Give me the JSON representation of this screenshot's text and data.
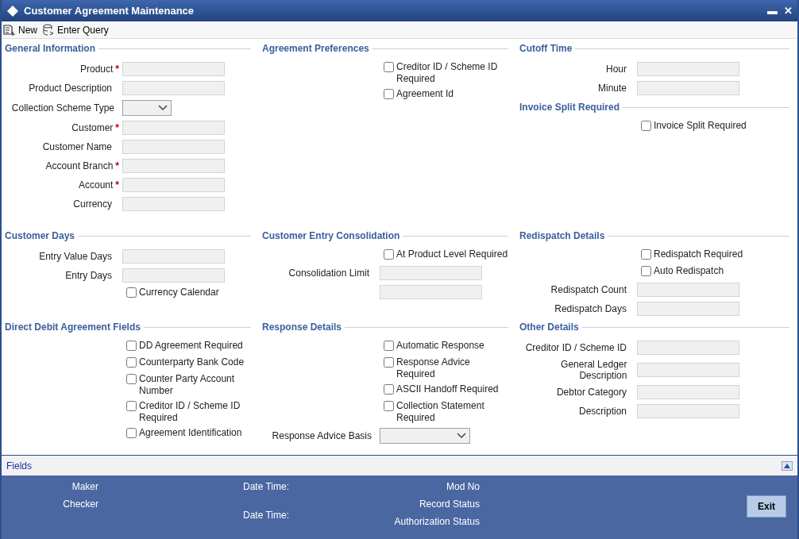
{
  "window": {
    "title": "Customer Agreement Maintenance",
    "controls": [
      "▬",
      "✕"
    ]
  },
  "toolbar": [
    {
      "label": "New",
      "kind": "new"
    },
    {
      "label": "Enter Query",
      "kind": "query"
    }
  ],
  "bands": [
    [
      [
        {
          "title": "General Information",
          "items": [
            {
              "kind": "field",
              "label": "Product",
              "required_mark": "*"
            },
            {
              "kind": "field",
              "label": "Product Description"
            },
            {
              "kind": "select",
              "label": "Collection Scheme Type"
            },
            {
              "kind": "field",
              "label": "Customer",
              "required_mark": "*"
            },
            {
              "kind": "field",
              "label": "Customer Name"
            },
            {
              "kind": "field",
              "label": "Account Branch",
              "required_mark": "*"
            },
            {
              "kind": "field",
              "label": "Account",
              "required_mark": "*"
            },
            {
              "kind": "field",
              "label": "Currency"
            }
          ]
        }
      ],
      [
        {
          "title": "Agreement Preferences",
          "items": [
            {
              "kind": "checkbox",
              "label": "Creditor ID / Scheme ID Required",
              "checked": false
            },
            {
              "kind": "checkbox",
              "label": "Agreement Id",
              "checked": false
            }
          ]
        }
      ],
      [
        {
          "title": "Cutoff Time",
          "items": [
            {
              "kind": "field",
              "label": "Hour"
            },
            {
              "kind": "field",
              "label": "Minute"
            }
          ]
        },
        {
          "title": "Invoice Split Required",
          "items": [
            {
              "kind": "checkbox",
              "label": "Invoice Split Required",
              "checked": false
            }
          ]
        }
      ]
    ],
    [
      [
        {
          "title": "Customer Days",
          "items": [
            {
              "kind": "field",
              "label": "Entry Value Days"
            },
            {
              "kind": "field",
              "label": "Entry Days"
            },
            {
              "kind": "checkbox",
              "label": "Currency Calendar",
              "checked": false
            }
          ]
        }
      ],
      [
        {
          "title": "Customer Entry Consolidation",
          "items": [
            {
              "kind": "checkbox",
              "label": "At Product Level Required",
              "checked": false
            },
            {
              "kind": "field",
              "label": "Consolidation Limit"
            },
            {
              "kind": "field"
            }
          ]
        }
      ],
      [
        {
          "title": "Redispatch Details",
          "items": [
            {
              "kind": "checkbox",
              "label": "Redispatch Required",
              "checked": false
            },
            {
              "kind": "checkbox",
              "label": "Auto Redispatch",
              "checked": false
            },
            {
              "kind": "field",
              "label": "Redispatch Count"
            },
            {
              "kind": "field",
              "label": "Redispatch Days"
            }
          ]
        }
      ]
    ],
    [
      [
        {
          "title": "Direct Debit Agreement Fields",
          "items": [
            {
              "kind": "checkbox",
              "label": "DD Agreement Required",
              "checked": false
            },
            {
              "kind": "checkbox",
              "label": "Counterparty Bank Code",
              "checked": false
            },
            {
              "kind": "checkbox",
              "label": "Counter Party Account Number",
              "checked": false
            },
            {
              "kind": "checkbox",
              "label": "Creditor ID / Scheme ID Required",
              "checked": false
            },
            {
              "kind": "checkbox",
              "label": "Agreement Identification",
              "checked": false
            }
          ]
        }
      ],
      [
        {
          "title": "Response Details",
          "items": [
            {
              "kind": "checkbox",
              "label": "Automatic Response",
              "checked": false
            },
            {
              "kind": "checkbox",
              "label": "Response Advice Required",
              "checked": false
            },
            {
              "kind": "checkbox",
              "label": "ASCII Handoff Required",
              "checked": false
            },
            {
              "kind": "checkbox",
              "label": "Collection Statement Required",
              "checked": false
            },
            {
              "kind": "wide_select",
              "label": "Response Advice Basis"
            }
          ]
        }
      ],
      [
        {
          "title": "Other Details",
          "items": [
            {
              "kind": "field",
              "label": "Creditor ID / Scheme ID"
            },
            {
              "kind": "field",
              "label": "General Ledger Description"
            },
            {
              "kind": "field",
              "label": "Debtor Category"
            },
            {
              "kind": "field",
              "label": "Description"
            }
          ]
        }
      ]
    ]
  ],
  "fields_bar": {
    "label": "Fields"
  },
  "audit": [
    [
      "Maker",
      "Checker"
    ],
    [
      "Date Time:",
      "Date Time:"
    ],
    [
      "Mod No",
      "Record Status",
      "Authorization Status"
    ]
  ],
  "exit_button": "Exit"
}
